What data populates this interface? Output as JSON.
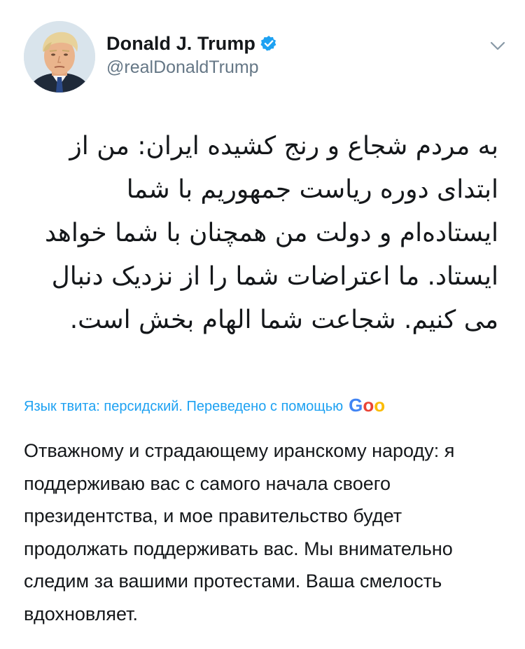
{
  "author": {
    "display_name": "Donald J. Trump",
    "handle": "@realDonaldTrump",
    "verified": true,
    "avatar_icon": "profile-photo-icon"
  },
  "tweet": {
    "language": "fa",
    "text": "به مردم شجاع و رنج کشیده ایران: من از ابتدای دوره ریاست جمهوریم با شما ایستاده‌ام و دولت من همچنان با شما خواهد ایستاد. ما اعتراضات شما را از نزدیک دنبال می کنیم. شجاعت شما الهام بخش است."
  },
  "translation": {
    "notice": "Язык твита: персидский. Переведено с помощью",
    "provider": "Goo",
    "text": "Отважному и страдающему иранскому народу: я поддерживаю вас с самого начала своего президентства, и мое правительство будет продолжать поддерживать вас. Мы внимательно следим за вашими протестами. Ваша смелость вдохновляет."
  },
  "colors": {
    "link": "#1da1f2",
    "secondary_text": "#657786",
    "primary_text": "#14171a",
    "verified_badge": "#1da1f2"
  }
}
